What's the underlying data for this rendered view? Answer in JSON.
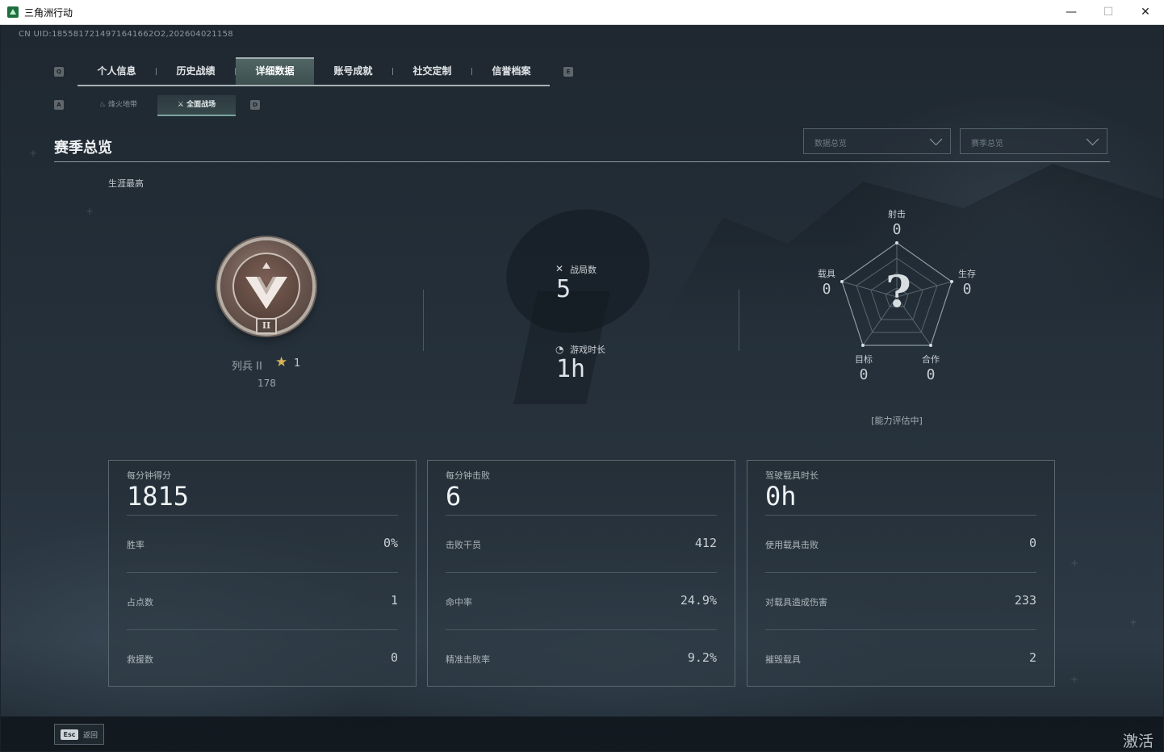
{
  "window": {
    "title": "三角洲行动",
    "minimize_glyph": "—",
    "maximize_glyph": "☐",
    "close_glyph": "✕"
  },
  "header": {
    "uid": "CN UID:1855817214971641662O2,202604021158"
  },
  "tabs": {
    "left_key": "Q",
    "right_key": "E",
    "items": [
      {
        "label": "个人信息"
      },
      {
        "label": "历史战绩"
      },
      {
        "label": "详细数据",
        "active": true
      },
      {
        "label": "账号成就"
      },
      {
        "label": "社交定制"
      },
      {
        "label": "信誉档案"
      }
    ]
  },
  "subtabs": {
    "left_key": "A",
    "right_key": "D",
    "items": [
      {
        "label": "烽火地带",
        "icon": "fire-icon"
      },
      {
        "label": "全面战场",
        "icon": "battlefield-icon",
        "active": true
      }
    ]
  },
  "section": {
    "title": "赛季总览",
    "dropdown_data": "数据总览",
    "dropdown_season": "赛季总览",
    "career_label": "生涯最高"
  },
  "rank": {
    "name": "列兵 II",
    "tier_numeral": "II",
    "star_icon": "star-icon",
    "stars": "1",
    "points": "178"
  },
  "summary": {
    "matches_label": "战局数",
    "matches_value": "5",
    "playtime_label": "游戏时长",
    "playtime_value": "1h"
  },
  "radar": {
    "placeholder": "?",
    "status": "[能力评估中]",
    "axes": [
      {
        "label": "射击",
        "value": "0"
      },
      {
        "label": "生存",
        "value": "0"
      },
      {
        "label": "合作",
        "value": "0"
      },
      {
        "label": "目标",
        "value": "0"
      },
      {
        "label": "载具",
        "value": "0"
      }
    ]
  },
  "cards": [
    {
      "head_label": "每分钟得分",
      "head_value": "1815",
      "rows": [
        {
          "label": "胜率",
          "value": "0%"
        },
        {
          "label": "占点数",
          "value": "1"
        },
        {
          "label": "救援数",
          "value": "0"
        }
      ]
    },
    {
      "head_label": "每分钟击败",
      "head_value": "6",
      "rows": [
        {
          "label": "击败干员",
          "value": "412"
        },
        {
          "label": "命中率",
          "value": "24.9%"
        },
        {
          "label": "精准击败率",
          "value": "9.2%"
        }
      ]
    },
    {
      "head_label": "驾驶载具时长",
      "head_value": "0h",
      "rows": [
        {
          "label": "使用载具击败",
          "value": "0"
        },
        {
          "label": "对载具造成伤害",
          "value": "233"
        },
        {
          "label": "摧毁载具",
          "value": "2"
        }
      ]
    }
  ],
  "footer": {
    "esc_key": "Esc",
    "esc_label": "返回",
    "watermark": "激活 \\"
  },
  "colors": {
    "accent_active_tab": "#516565",
    "star": "#d8b35a",
    "background": "#1f2830"
  }
}
